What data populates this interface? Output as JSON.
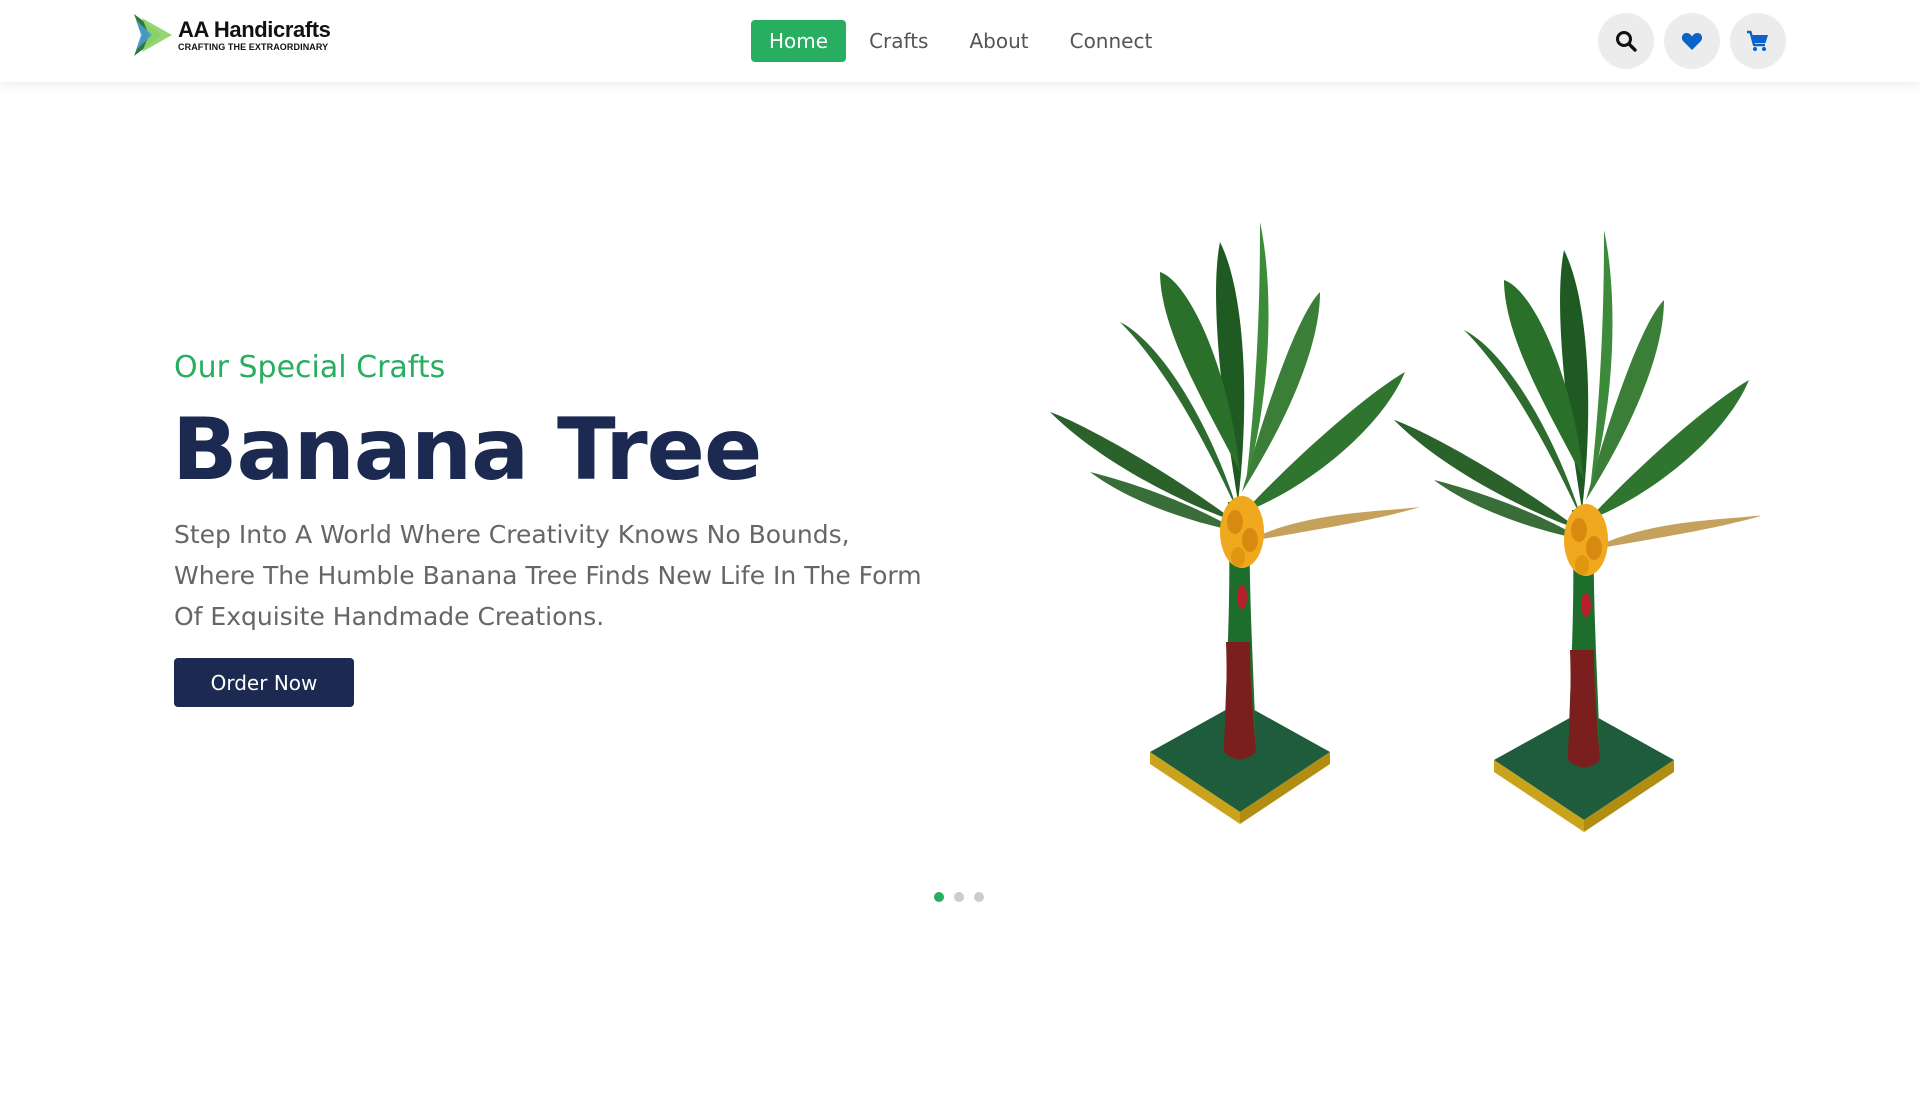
{
  "brand": {
    "name": "AA Handicrafts",
    "tagline": "CRAFTING THE EXTRAORDINARY"
  },
  "nav": {
    "items": [
      {
        "label": "Home",
        "active": true
      },
      {
        "label": "Crafts",
        "active": false
      },
      {
        "label": "About",
        "active": false
      },
      {
        "label": "Connect",
        "active": false
      }
    ]
  },
  "header_icons": [
    "search-icon",
    "heart-icon",
    "cart-icon"
  ],
  "hero": {
    "subtitle": "Our Special Crafts",
    "title": "Banana Tree",
    "description": "Step Into A World Where Creativity Knows No Bounds, Where The Humble Banana Tree Finds New Life In The Form Of Exquisite Handmade Creations.",
    "cta_label": "Order Now"
  },
  "carousel": {
    "slides": 3,
    "active_index": 0
  },
  "colors": {
    "accent_green": "#27ae60",
    "navy": "#1c2a52",
    "text_gray": "#666666",
    "icon_bg": "#ececec",
    "heart_blue": "#0b63c9",
    "cart_blue": "#0b63c9"
  }
}
